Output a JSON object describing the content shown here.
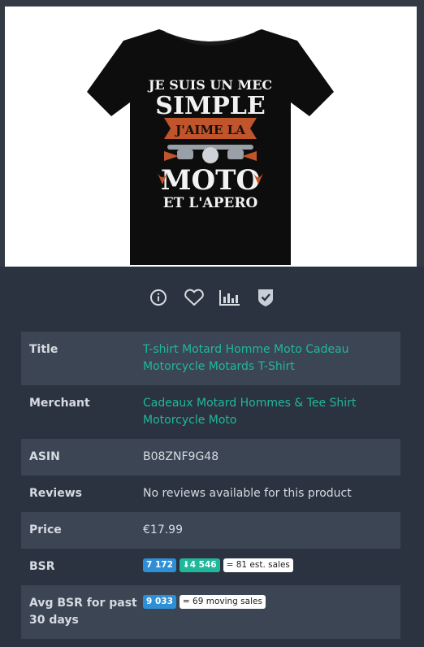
{
  "product_image": {
    "shirt_lines": [
      "JE SUIS UN MEC",
      "SIMPLE",
      "J'AIME LA",
      "MOTO",
      "ET L'APERO"
    ]
  },
  "actions": [
    {
      "name": "info-icon"
    },
    {
      "name": "heart-icon"
    },
    {
      "name": "bar-chart-icon"
    },
    {
      "name": "shield-check-icon"
    }
  ],
  "details": {
    "title_label": "Title",
    "title_value": "T-shirt Motard Homme Moto Cadeau Motorcycle Motards T-Shirt",
    "merchant_label": "Merchant",
    "merchant_value": "Cadeaux Motard Hommes & Tee Shirt Motorcycle Moto",
    "asin_label": "ASIN",
    "asin_value": "B08ZNF9G48",
    "reviews_label": "Reviews",
    "reviews_value": "No reviews available for this product",
    "price_label": "Price",
    "price_value": "€17.99",
    "bsr_label": "BSR",
    "bsr_current": "7 172",
    "bsr_change": "⬇4 546",
    "bsr_sales": "= 81 est. sales",
    "avg_bsr_label": "Avg BSR for past 30 days",
    "avg_bsr_value": "9 033",
    "avg_bsr_sales": "= 69 moving sales"
  },
  "colors": {
    "background": "#2b3340",
    "row_alt": "#3b4554",
    "link": "#1fb89a",
    "badge_blue": "#2e8fd6",
    "badge_green": "#1fb89a"
  }
}
